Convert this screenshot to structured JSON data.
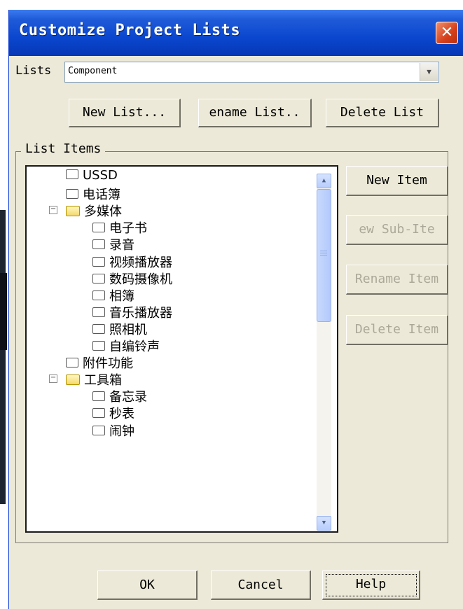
{
  "dialog": {
    "title": "Customize Project Lists",
    "close_label": "✕"
  },
  "lists": {
    "label": "Lists",
    "selected": "Component"
  },
  "buttons": {
    "new_list": "New List...",
    "rename_list": "ename List..",
    "delete_list": "Delete List",
    "new_item": "New Item",
    "new_sub_item": "ew Sub-Ite",
    "rename_item": "Rename Item",
    "delete_item": "Delete Item",
    "ok": "OK",
    "cancel": "Cancel",
    "help": "Help"
  },
  "group": {
    "label": "List Items"
  },
  "tree": [
    {
      "label": "USSD",
      "type": "file",
      "level": 0
    },
    {
      "label": "电话簿",
      "type": "file",
      "level": 0
    },
    {
      "label": "多媒体",
      "type": "folder",
      "level": 0,
      "expanded": true
    },
    {
      "label": "电子书",
      "type": "file",
      "level": 1
    },
    {
      "label": "录音",
      "type": "file",
      "level": 1
    },
    {
      "label": "视频播放器",
      "type": "file",
      "level": 1
    },
    {
      "label": "数码摄像机",
      "type": "file",
      "level": 1
    },
    {
      "label": "相簿",
      "type": "file",
      "level": 1
    },
    {
      "label": "音乐播放器",
      "type": "file",
      "level": 1
    },
    {
      "label": "照相机",
      "type": "file",
      "level": 1
    },
    {
      "label": "自编铃声",
      "type": "file",
      "level": 1
    },
    {
      "label": "附件功能",
      "type": "file",
      "level": 0
    },
    {
      "label": "工具箱",
      "type": "folder",
      "level": 0,
      "expanded": true
    },
    {
      "label": "备忘录",
      "type": "file",
      "level": 1
    },
    {
      "label": "秒表",
      "type": "file",
      "level": 1
    },
    {
      "label": "闹钟",
      "type": "file",
      "level": 1
    }
  ],
  "colors": {
    "title_bar": "#0a47cf",
    "dialog_bg": "#ece9d8",
    "close_button": "#d4401a",
    "disabled_text": "#aca899"
  }
}
